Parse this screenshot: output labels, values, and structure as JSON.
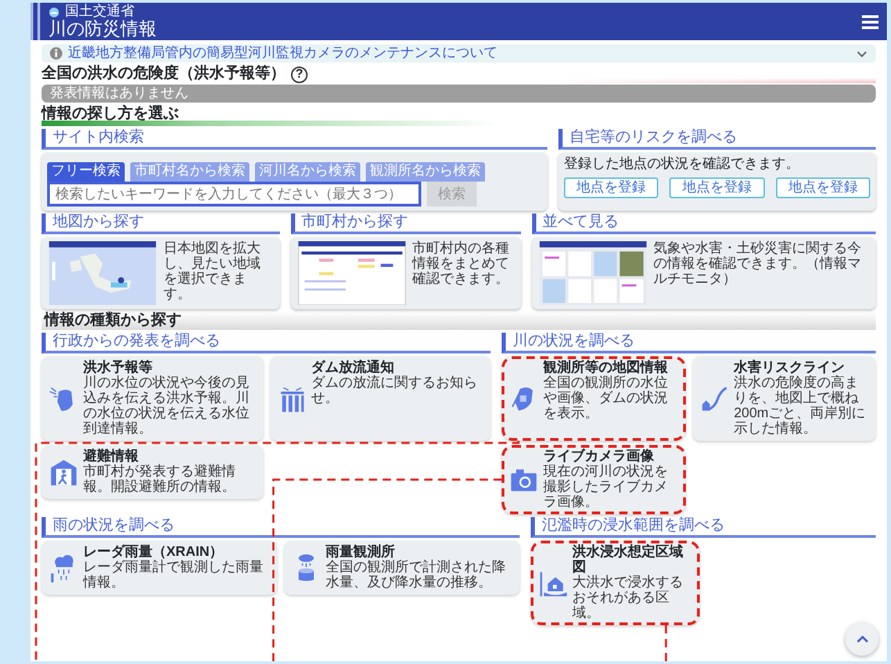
{
  "header": {
    "ministry": "国土交通省",
    "title": "川の防災情報"
  },
  "notice": {
    "text": "近畿地方整備局管内の簡易型河川監視カメラのメンテナンスについて",
    "expanded": false
  },
  "danger": {
    "heading": "全国の洪水の危険度（洪水予報等）",
    "help": "?",
    "status": "発表情報はありません"
  },
  "how_heading": "情報の探し方を選ぶ",
  "site_search": {
    "heading": "サイト内検索",
    "tabs": [
      {
        "label": "フリー検索",
        "selected": true
      },
      {
        "label": "市町村名から検索",
        "selected": false
      },
      {
        "label": "河川名から検索",
        "selected": false
      },
      {
        "label": "観測所名から検索",
        "selected": false
      }
    ],
    "placeholder": "検索したいキーワードを入力してください（最大３つ）",
    "button": "検索",
    "button_disabled": true
  },
  "home_risk": {
    "heading": "自宅等のリスクを調べる",
    "text": "登録した地点の状況を確認できます。",
    "buttons": [
      "地点を登録",
      "地点を登録",
      "地点を登録"
    ]
  },
  "browse": [
    {
      "heading": "地図から探す",
      "kind": "map",
      "text": "日本地図を拡大し、見たい地域を選択できます。"
    },
    {
      "heading": "市町村から探す",
      "kind": "list",
      "text": "市町村内の各種情報をまとめて確認できます。"
    },
    {
      "heading": "並べて見る",
      "kind": "dashboard",
      "text": "気象や水害・土砂災害に関する今の情報を確認できます。（情報マルチモニタ）"
    }
  ],
  "types_heading": "情報の種類から探す",
  "groups": [
    {
      "heading": "行政からの発表を調べる",
      "cards": [
        {
          "kind": "hand",
          "title": "洪水予報等",
          "text": "川の水位の状況や今後の見込みを伝える洪水予報。川の水位の状況を伝える水位到達情報。",
          "highlighted": false
        },
        {
          "kind": "dam",
          "title": "ダム放流通知",
          "text": "ダムの放流に関するお知らせ。",
          "highlighted": false
        },
        {
          "kind": "evacuation",
          "title": "避難情報",
          "text": "市町村が発表する避難情報。開設避難所の情報。",
          "highlighted": false
        }
      ]
    },
    {
      "heading": "川の状況を調べる",
      "cards": [
        {
          "kind": "map",
          "title": "観測所等の地図情報",
          "text": "全国の観測所の水位や画像、ダムの状況を表示。",
          "highlighted": true,
          "connector": {
            "kind": "left-to-edge"
          }
        },
        {
          "kind": "riskline",
          "title": "水害リスクライン",
          "text": "洪水の危険度の高まりを、地図上で概ね200mごと、両岸別に示した情報。",
          "highlighted": false
        },
        {
          "kind": "camera",
          "title": "ライブカメラ画像",
          "text": "現在の河川の状況を撮影したライブカメラ画像。",
          "highlighted": true,
          "connector": {
            "kind": "left-to-middle"
          }
        }
      ]
    },
    {
      "heading": "雨の状況を調べる",
      "cards": [
        {
          "kind": "radar",
          "title": "レーダ雨量（XRAIN）",
          "text": "レーダ雨量計で観測した雨量情報。",
          "highlighted": false
        },
        {
          "kind": "gauge",
          "title": "雨量観測所",
          "text": "全国の観測所で計測された降水量、及び降水量の推移。",
          "highlighted": false
        }
      ]
    },
    {
      "heading": "氾濫時の浸水範囲を調べる",
      "cards": [
        {
          "kind": "flood",
          "title": "洪水浸水想定区域図",
          "text": "大洪水で浸水するおそれがある区域。",
          "highlighted": true,
          "connector": {
            "kind": "down"
          }
        }
      ]
    }
  ]
}
